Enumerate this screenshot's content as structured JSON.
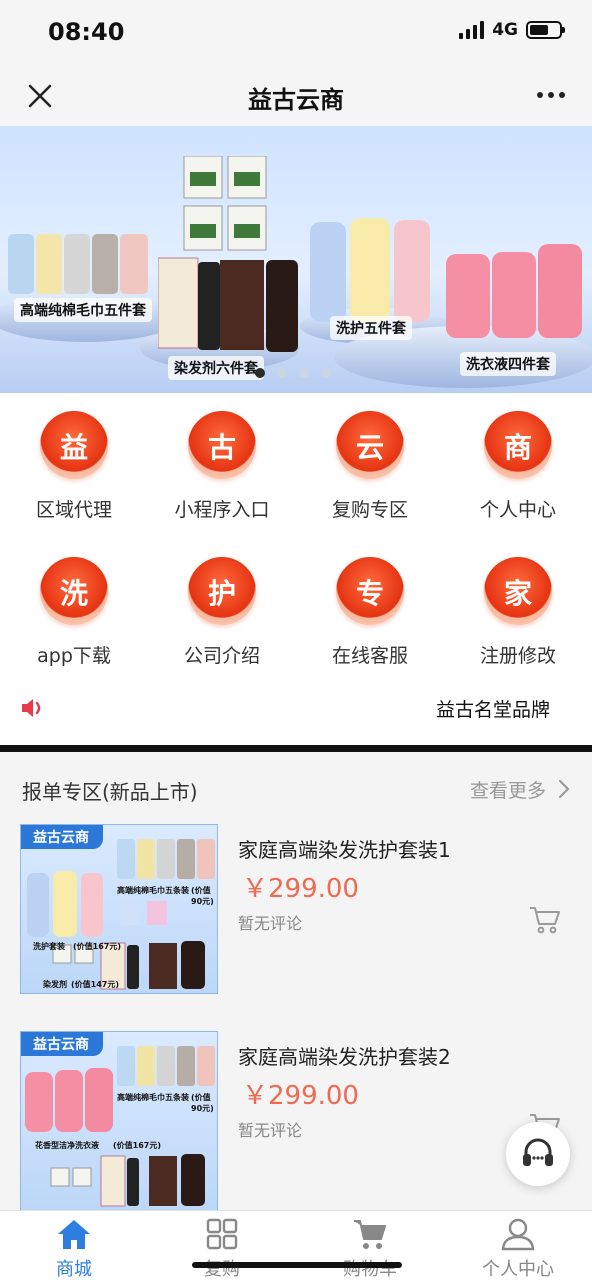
{
  "status_bar": {
    "time": "08:40",
    "network": "4G",
    "battery_percent": 65
  },
  "nav": {
    "title": "益古云商",
    "close_icon": "close-icon",
    "more_icon": "more-dots-icon"
  },
  "banner": {
    "labels": [
      "高端纯棉毛巾五件套",
      "染发剂六件套",
      "洗护五件套",
      "洗衣液四件套"
    ],
    "dots_total": 4,
    "dot_active": 1
  },
  "menu": [
    {
      "glyph": "益",
      "label": "区域代理"
    },
    {
      "glyph": "古",
      "label": "小程序入口"
    },
    {
      "glyph": "云",
      "label": "复购专区"
    },
    {
      "glyph": "商",
      "label": "个人中心"
    },
    {
      "glyph": "洗",
      "label": "app下载"
    },
    {
      "glyph": "护",
      "label": "公司介绍"
    },
    {
      "glyph": "专",
      "label": "在线客服"
    },
    {
      "glyph": "家",
      "label": "注册修改"
    }
  ],
  "notice": {
    "icon": "speaker-icon",
    "text": "益古名堂品牌"
  },
  "section": {
    "title": "报单专区(新品上市)",
    "more": "查看更多"
  },
  "products": [
    {
      "name": "家庭高端染发洗护套装1",
      "price": "￥299.00",
      "reviews": "暂无评论",
      "thumb_tag": "益古云商",
      "thumb_captions": [
        "高端纯棉毛巾五条装",
        "(价值90元)",
        "洗护套装",
        "(价值167元)",
        "染发剂",
        "(价值147元)"
      ]
    },
    {
      "name": "家庭高端染发洗护套装2",
      "price": "￥299.00",
      "reviews": "暂无评论",
      "thumb_tag": "益古云商",
      "thumb_captions": [
        "高端纯棉毛巾五条装",
        "(价值90元)",
        "花香型洁净洗衣液",
        "(价值167元)"
      ]
    }
  ],
  "tabs": [
    {
      "label": "商城",
      "icon": "home-icon",
      "active": true
    },
    {
      "label": "复购",
      "icon": "grid-icon",
      "active": false
    },
    {
      "label": "购物车",
      "icon": "cart-icon",
      "active": false
    },
    {
      "label": "个人中心",
      "icon": "user-icon",
      "active": false
    }
  ],
  "colors": {
    "accent_blue": "#2d7ee0",
    "price_red": "#f06a50",
    "menu_icon_red": "#e53312"
  }
}
